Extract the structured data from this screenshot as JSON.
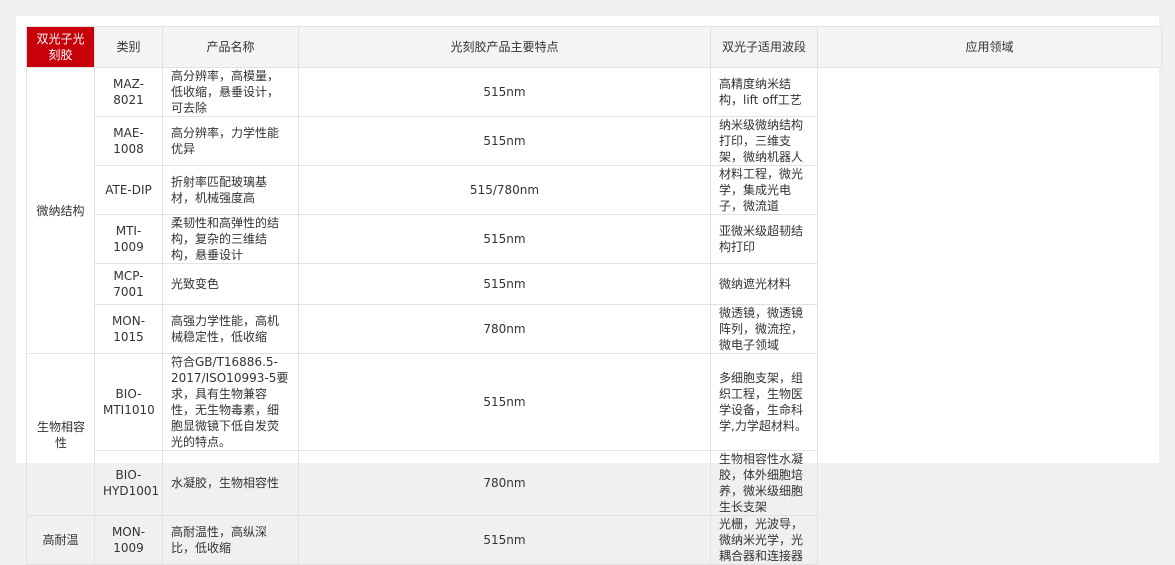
{
  "headers": {
    "category": "类别",
    "product": "产品名称",
    "features": "光刻胶产品主要特点",
    "wavelength": "双光子适用波段",
    "application": "应用领域"
  },
  "main_category": "双光子光刻胶",
  "subcategories": [
    "微纳结构",
    "生物相容性",
    "高耐温"
  ],
  "rows": [
    {
      "product": "MAZ-8021",
      "features": "高分辨率，高模量，低收缩，悬垂设计，可去除",
      "wavelength": "515nm",
      "application": "高精度纳米结构，lift off工艺"
    },
    {
      "product": "MAE-1008",
      "features": "高分辨率，力学性能优异",
      "wavelength": "515nm",
      "application": "纳米级微纳结构打印，三维支架，微纳机器人"
    },
    {
      "product": "ATE-DIP",
      "features": "折射率匹配玻璃基材，机械强度高",
      "wavelength": "515/780nm",
      "application": "材料工程，微光学，集成光电子，微流道"
    },
    {
      "product": "MTI-1009",
      "features": "柔韧性和高弹性的结构，复杂的三维结构，悬垂设计",
      "wavelength": "515nm",
      "application": "亚微米级超韧结构打印"
    },
    {
      "product": "MCP-7001",
      "features": "光致变色",
      "wavelength": "515nm",
      "application": "微纳遮光材料"
    },
    {
      "product": "MON-1015",
      "features": "高强力学性能，高机械稳定性，低收缩",
      "wavelength": "780nm",
      "application": "微透镜，微透镜阵列，微流控，微电子领域"
    },
    {
      "product": "BIO-MTI1010",
      "features": "符合GB/T16886.5-2017/ISO10993-5要求，具有生物兼容性，无生物毒素，细胞显微镜下低自发荧光的特点。",
      "wavelength": "515nm",
      "application": "多细胞支架，组织工程，生物医学设备，生命科学,力学超材料。"
    },
    {
      "product": "BIO-HYD1001",
      "features": "水凝胶，生物相容性",
      "wavelength": "780nm",
      "application": "生物相容性水凝胶，体外细胞培养，微米级细胞生长支架"
    },
    {
      "product": "MON-1009",
      "features": "高耐温性，高纵深比，低收缩",
      "wavelength": "515nm",
      "application": "光栅，光波导，微纳米光学，光耦合器和连接器"
    }
  ],
  "colors": {
    "accent": "#c8000a",
    "header_bg": "#f4f4f4",
    "border": "#e2e2e2"
  }
}
